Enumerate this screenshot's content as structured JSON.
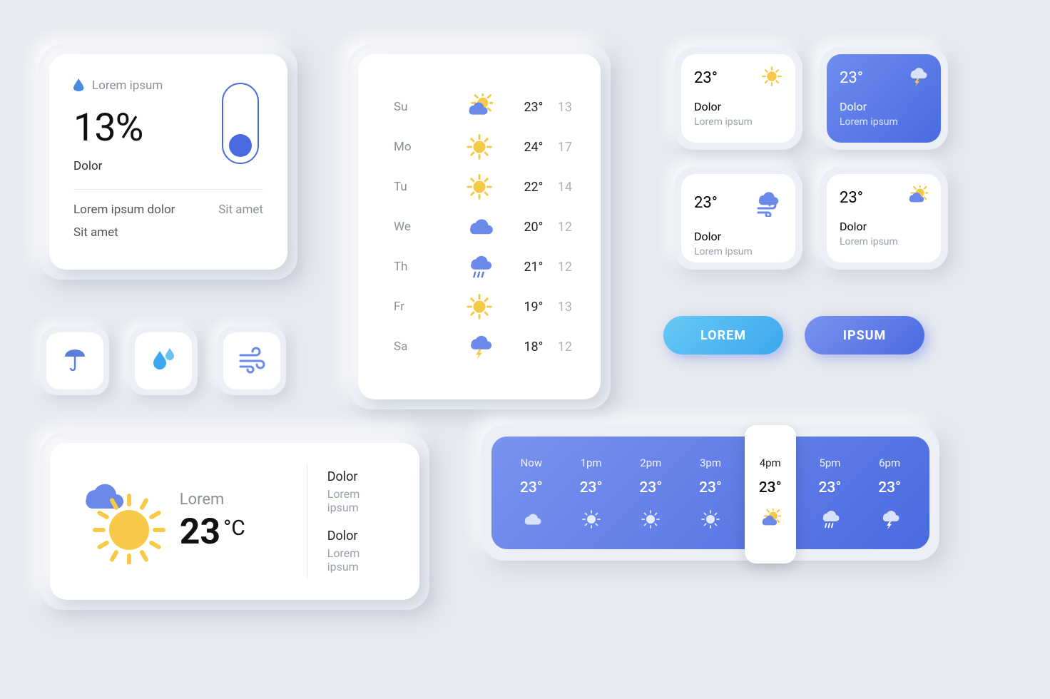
{
  "humidity": {
    "label": "Lorem ipsum",
    "value": "13%",
    "sub": "Dolor",
    "row1_left": "Lorem ipsum dolor",
    "row1_right": "Sit amet",
    "row2_left": "Sit amet"
  },
  "forecast": [
    {
      "day": "Su",
      "icon": "partly",
      "hi": "23°",
      "lo": "13"
    },
    {
      "day": "Mo",
      "icon": "sun",
      "hi": "24°",
      "lo": "17"
    },
    {
      "day": "Tu",
      "icon": "sun",
      "hi": "22°",
      "lo": "14"
    },
    {
      "day": "We",
      "icon": "cloud",
      "hi": "20°",
      "lo": "12"
    },
    {
      "day": "Th",
      "icon": "rain",
      "hi": "21°",
      "lo": "12"
    },
    {
      "day": "Fr",
      "icon": "sun",
      "hi": "19°",
      "lo": "13"
    },
    {
      "day": "Sa",
      "icon": "storm",
      "hi": "18°",
      "lo": "12"
    }
  ],
  "small_cards": [
    {
      "temp": "23°",
      "icon": "sun",
      "title": "Dolor",
      "sub": "Lorem ipsum",
      "blue": false
    },
    {
      "temp": "23°",
      "icon": "storm-w",
      "title": "Dolor",
      "sub": "Lorem ipsum",
      "blue": true
    },
    {
      "temp": "23°",
      "icon": "windcloud",
      "title": "Dolor",
      "sub": "Lorem ipsum",
      "blue": false
    },
    {
      "temp": "23°",
      "icon": "partly",
      "title": "Dolor",
      "sub": "Lorem ipsum",
      "blue": false
    }
  ],
  "buttons": {
    "a": "LOREM",
    "b": "IPSUM"
  },
  "tiles": [
    "umbrella",
    "drops",
    "wind"
  ],
  "current": {
    "label": "Lorem",
    "temp": "23",
    "unit": "°C",
    "right": [
      {
        "title": "Dolor",
        "sub": "Lorem ipsum"
      },
      {
        "title": "Dolor",
        "sub": "Lorem ipsum"
      }
    ]
  },
  "hourly": [
    {
      "time": "Now",
      "temp": "23°",
      "icon": "cloud-w"
    },
    {
      "time": "1pm",
      "temp": "23°",
      "icon": "sun-w"
    },
    {
      "time": "2pm",
      "temp": "23°",
      "icon": "sun-w"
    },
    {
      "time": "3pm",
      "temp": "23°",
      "icon": "sun-w"
    },
    {
      "time": "4pm",
      "temp": "23°",
      "icon": "partly",
      "selected": true
    },
    {
      "time": "5pm",
      "temp": "23°",
      "icon": "rain-w"
    },
    {
      "time": "6pm",
      "temp": "23°",
      "icon": "storm-w2"
    }
  ]
}
